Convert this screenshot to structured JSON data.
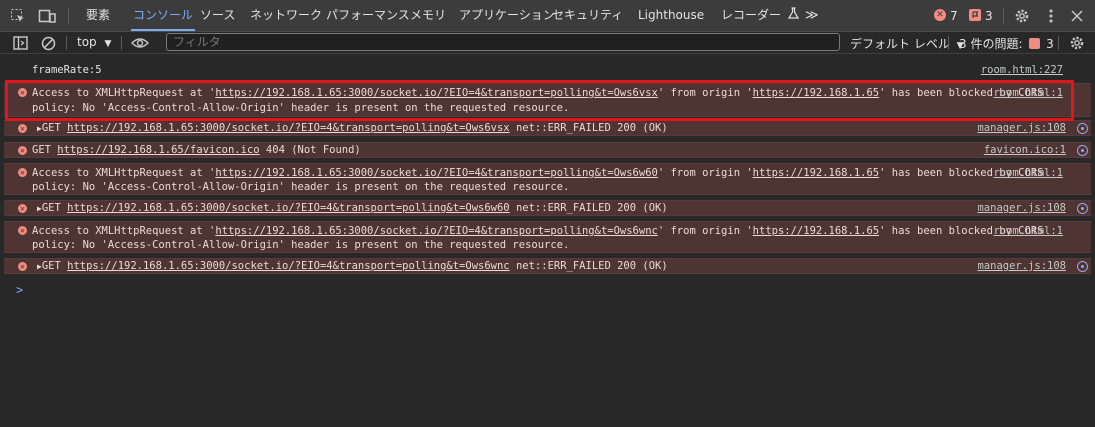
{
  "tabs": [
    "要素",
    "コンソール",
    "ソース",
    "ネットワーク",
    "パフォーマンス",
    "メモリ",
    "アプリケーション",
    "セキュリティ",
    "Lighthouse",
    "レコーダー"
  ],
  "active_tab": "コンソール",
  "more_tabs_label": "≫",
  "error_count": "7",
  "issue_count": "3",
  "toolbar": {
    "context": "top",
    "filter_placeholder": "フィルタ",
    "levels": "デフォルト レベル",
    "issues_label": "3 件の問題:",
    "issues_badge": "3"
  },
  "log": [
    {
      "type": "log",
      "text": "frameRate:5",
      "source": "room.html:227"
    },
    {
      "type": "cors",
      "url": "https://192.168.1.65:3000/socket.io/?EIO=4&transport=polling&t=Ows6vsx",
      "origin": "https://192.168.1.65",
      "source": "room.html:1"
    },
    {
      "type": "get",
      "url": "https://192.168.1.65:3000/socket.io/?EIO=4&transport=polling&t=Ows6vsx",
      "status": "net::ERR_FAILED 200 (OK)",
      "source": "manager.js:108"
    },
    {
      "type": "get404",
      "url": "https://192.168.1.65/favicon.ico",
      "status": "404 (Not Found)",
      "source": "favicon.ico:1"
    },
    {
      "type": "cors",
      "url": "https://192.168.1.65:3000/socket.io/?EIO=4&transport=polling&t=Ows6w60",
      "origin": "https://192.168.1.65",
      "source": "room.html:1"
    },
    {
      "type": "get",
      "url": "https://192.168.1.65:3000/socket.io/?EIO=4&transport=polling&t=Ows6w60",
      "status": "net::ERR_FAILED 200 (OK)",
      "source": "manager.js:108"
    },
    {
      "type": "cors",
      "url": "https://192.168.1.65:3000/socket.io/?EIO=4&transport=polling&t=Ows6wnc",
      "origin": "https://192.168.1.65",
      "source": "room.html:1"
    },
    {
      "type": "get",
      "url": "https://192.168.1.65:3000/socket.io/?EIO=4&transport=polling&t=Ows6wnc",
      "status": "net::ERR_FAILED 200 (OK)",
      "source": "manager.js:108"
    }
  ],
  "text": {
    "cors_prefix": "Access to XMLHttpRequest at '",
    "cors_mid": "' from origin '",
    "cors_suffix": "' has been blocked by CORS",
    "cors_line2": "policy: No 'Access-Control-Allow-Origin' header is present on the requested resource.",
    "get_prefix": "GET",
    "prompt": ">"
  },
  "colors": {
    "accent": "#7cacf8",
    "error": "#f28b82",
    "highlight": "#e0161a"
  },
  "icons": [
    "inspect-element-icon",
    "device-toolbar-icon",
    "error-circle-icon",
    "issue-flag-icon",
    "gear-icon",
    "kebab-menu-icon",
    "close-icon",
    "sidebar-toggle-icon",
    "clear-console-icon",
    "eye-icon",
    "network-globe-icon"
  ]
}
